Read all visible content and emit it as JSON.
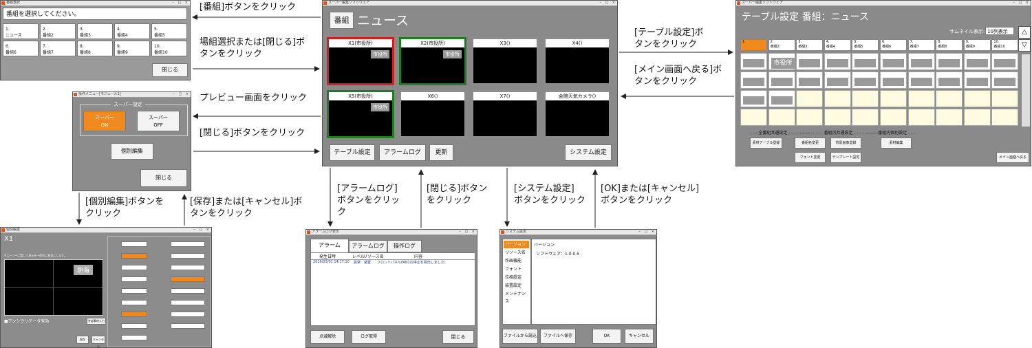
{
  "program_dialog": {
    "title": "番組選択",
    "prompt": "番組を選択してください。",
    "programs": [
      {
        "no": "1.",
        "name": "ニュース"
      },
      {
        "no": "2.",
        "name": "番組2"
      },
      {
        "no": "3.",
        "name": "番組3"
      },
      {
        "no": "4.",
        "name": "番組4"
      },
      {
        "no": "5.",
        "name": "番組5"
      },
      {
        "no": "6.",
        "name": "番組6"
      },
      {
        "no": "7.",
        "name": "番組7"
      },
      {
        "no": "8.",
        "name": "番組8"
      },
      {
        "no": "9.",
        "name": "番組9"
      },
      {
        "no": "10.",
        "name": "番組10"
      }
    ],
    "close_label": "閉じる"
  },
  "ops_menu": {
    "title": "操作メニュー[モジュール1]",
    "group_label": "スーパー設定",
    "super_on": "スーパー\nON",
    "super_off": "スーパー\nOFF",
    "edit_label": "個別編集",
    "close_label": "閉じる"
  },
  "main": {
    "title_text": "スーパー編集ソフトウェア",
    "program_btn": "番組",
    "program_name": "ニュース",
    "cells": [
      {
        "title": "X1(市役所)",
        "badge": "市役所",
        "border": "#d21e1e"
      },
      {
        "title": "X2(市役所)",
        "badge": "市役所",
        "border": "#1e7d1e"
      },
      {
        "title": "X3()",
        "badge": "",
        "border": "#8c8c8c"
      },
      {
        "title": "X4()",
        "badge": "",
        "border": "#8c8c8c"
      },
      {
        "title": "X5(市役所)",
        "badge": "市役所",
        "border": "#1e7d1e"
      },
      {
        "title": "X6()",
        "badge": "",
        "border": "#8c8c8c"
      },
      {
        "title": "X7()",
        "badge": "",
        "border": "#8c8c8c"
      },
      {
        "title": "会館天気カメラ()",
        "badge": "",
        "border": "#8c8c8c"
      }
    ],
    "table_btn": "テーブル設定",
    "alarm_btn": "アラームログ",
    "update_btn": "更新",
    "system_btn": "システム設定"
  },
  "table_settings": {
    "title_text": "スーパー編集ソフトウェア",
    "heading": "テーブル設定 番組：ニュース",
    "thumb_label": "サムネイル表示:",
    "thumb_value": "10列表示",
    "columns": [
      "1.",
      "2.",
      "3.",
      "4.",
      "5.",
      "6.",
      "7.",
      "8.",
      "9.",
      "10."
    ],
    "column_names": [
      "",
      "番組2",
      "番組3",
      "番組4",
      "番組5",
      "番組6",
      "番組7",
      "番組8",
      "番組9",
      "番組10"
    ],
    "big_cell": "市役所",
    "section_common": "全番組共通設定",
    "section_program": "番組内共通設定",
    "section_individual": "番組内個別設定",
    "btn_common_table": "素材テーブル登録",
    "btn_rename": "番組名変更",
    "btn_bg": "背景画像登録",
    "btn_material": "素材編集",
    "btn_font": "フォント変更",
    "btn_template": "テンプレート設定",
    "btn_back": "メイン画面へ戻る"
  },
  "edit_screen": {
    "title": "個別編集",
    "module": "X1",
    "hint": "※スーパーに関して表示を一時的に無効にします。",
    "preview_badge": "熱海",
    "ancillary": "■アンシラリデータ有効",
    "save": "保存",
    "cancel": "キャンセル",
    "btn_preview": "外部素材入力"
  },
  "alarm_dialog": {
    "title": "アラームログ表示",
    "tabs": [
      "アラーム",
      "アラームログ",
      "操作ログ"
    ],
    "headers": [
      "発生日時",
      "レベル",
      "リソース名",
      "内容"
    ],
    "row": {
      "datetime": "2016/03/01 14:17:10",
      "level": "異常",
      "resource": "装置",
      "content": "フロントパネルFAN1の停止を検出しました。"
    },
    "btn_blink": "点滅解除",
    "btn_log": "ログ取得",
    "btn_close": "閉じる"
  },
  "system_dialog": {
    "title": "システム設定",
    "menu": [
      "バージョン",
      "リソース名",
      "作画機能",
      "フォント",
      "位相設定",
      "装置設定",
      "メンテナンス"
    ],
    "panel_title": "バージョン",
    "software_version": "ソフトウェア：1.0.0.5",
    "btn_load": "ファイルから読込",
    "btn_save": "ファイルへ保存",
    "btn_ok": "OK",
    "btn_cancel": "キャンセル"
  },
  "labels": {
    "a1": "[番組]ボタンをクリック",
    "a2": "場組選択または[閉じる]ボ\nタンをクリック",
    "a3": "プレビュー画面をクリック",
    "a4": "[閉じる]ボタンをクリック",
    "a5": "[テーブル設定]ボ\nタンをクリック",
    "a6": "[メイン画面へ戻る]ボ\nタンをクリック",
    "a7": "[個別編集]ボタンを\nクリック",
    "a8": "[保存]または[キャンセル]ボ\nタンをクリック",
    "a9": "[アラームログ]\nボタンをクリッ\nク",
    "a10": "[閉じる]ボタン\nをクリック",
    "a11": "[システム設定]\nボタンをクリック",
    "a12": "[OK]または[キャンセル]\nボタンをクリック"
  }
}
